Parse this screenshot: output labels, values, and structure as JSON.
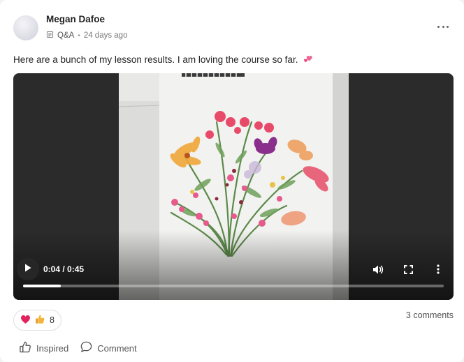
{
  "post": {
    "author": "Megan Dafoe",
    "space": "Q&A",
    "separator": "•",
    "timestamp": "24 days ago",
    "text": "Here are a bunch of my lesson results. I am loving the course so far.",
    "emoji": "two-hearts"
  },
  "video": {
    "current_time": "0:04",
    "duration": "0:45",
    "time_label": "0:04 / 0:45",
    "progress_fraction": 0.09
  },
  "reactions": {
    "icons": [
      "heart-icon",
      "thumbs-up-emoji-icon"
    ],
    "count": "8"
  },
  "comments_label": "3 comments",
  "actions": {
    "inspired_label": "Inspired",
    "comment_label": "Comment"
  },
  "colors": {
    "heart": "#e0245e",
    "thumb": "#f2b53a",
    "video_bg": "#2b2b2b"
  }
}
